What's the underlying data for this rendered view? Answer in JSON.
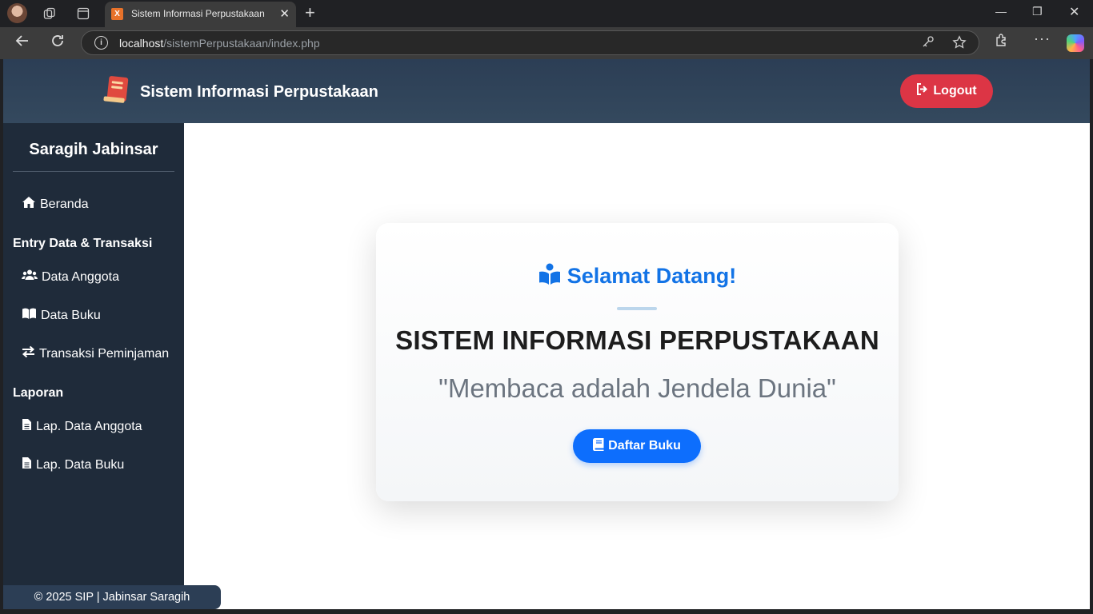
{
  "browser": {
    "tab_title": "Sistem Informasi Perpustakaan",
    "tab_favicon": "xampp-icon",
    "url_host": "localhost",
    "url_path": "/sistemPerpustakaan/index.php"
  },
  "header": {
    "brand": "Sistem Informasi Perpustakaan",
    "logout_label": "Logout"
  },
  "sidebar": {
    "user_name": "Saragih Jabinsar",
    "home_label": "Beranda",
    "section_entry": "Entry Data & Transaksi",
    "entry_items": [
      "Data Anggota",
      "Data Buku",
      "Transaksi Peminjaman"
    ],
    "section_report": "Laporan",
    "report_items": [
      "Lap. Data Anggota",
      "Lap. Data Buku"
    ],
    "footer": "© 2025 SIP | Jabinsar Saragih"
  },
  "main": {
    "welcome": "Selamat Datang!",
    "title": "SISTEM INFORMASI PERPUSTAKAAN",
    "quote": "\"Membaca adalah Jendela Dunia\"",
    "button_label": "Daftar Buku"
  },
  "colors": {
    "header": "#34495e",
    "sidebar": "#1f2b3a",
    "logout": "#dc3545",
    "primary": "#0d6efd",
    "welcome": "#1273e6"
  }
}
